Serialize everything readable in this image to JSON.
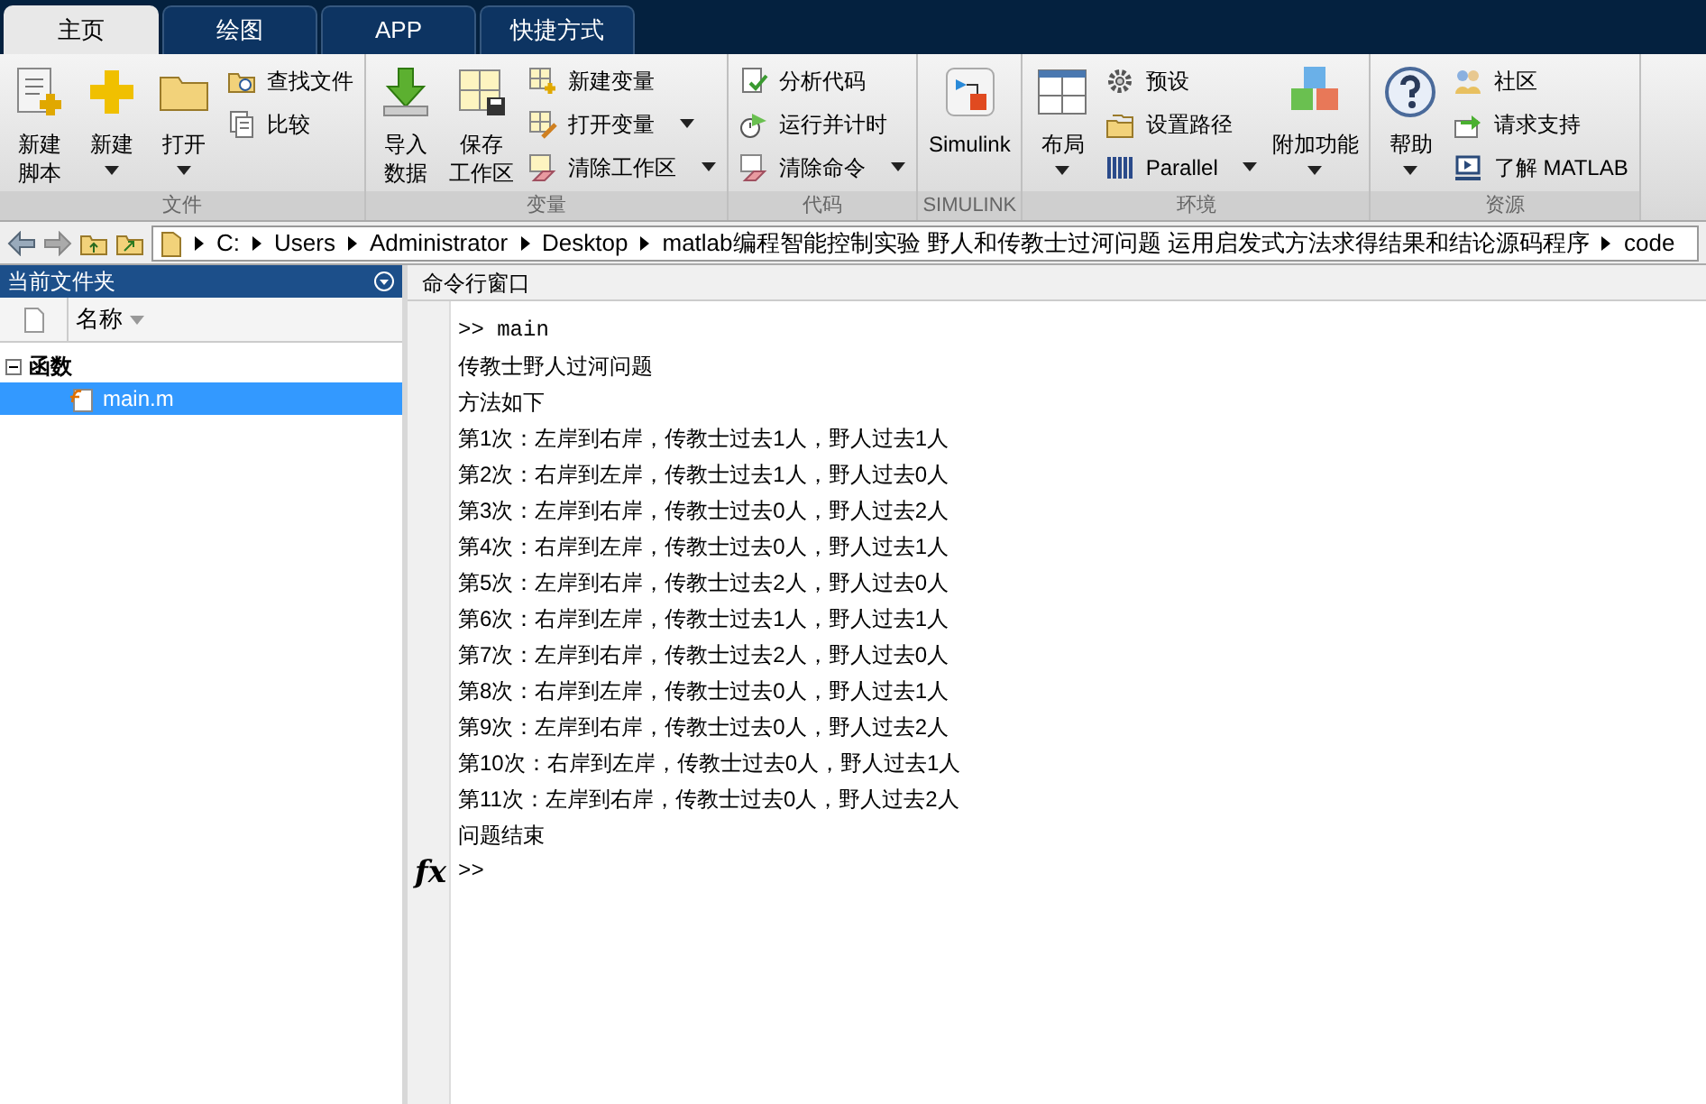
{
  "tabs": [
    {
      "label": "主页",
      "selected": true
    },
    {
      "label": "绘图",
      "selected": false
    },
    {
      "label": "APP",
      "selected": false
    },
    {
      "label": "快捷方式",
      "selected": false
    }
  ],
  "ribbon": {
    "groups": [
      {
        "label": "文件",
        "items": [
          {
            "kind": "large",
            "lines": [
              "新建",
              "脚本"
            ],
            "dropdown": false
          },
          {
            "kind": "large",
            "lines": [
              "新建"
            ],
            "dropdown": true
          },
          {
            "kind": "large",
            "lines": [
              "打开"
            ],
            "dropdown": true
          },
          {
            "kind": "stack",
            "items": [
              {
                "label": "查找文件",
                "dropdown": false
              },
              {
                "label": "比较",
                "dropdown": false
              }
            ]
          }
        ]
      },
      {
        "label": "变量",
        "items": [
          {
            "kind": "large",
            "lines": [
              "导入",
              "数据"
            ],
            "dropdown": false
          },
          {
            "kind": "large",
            "lines": [
              "保存",
              "工作区"
            ],
            "dropdown": false
          },
          {
            "kind": "stack",
            "items": [
              {
                "label": "新建变量",
                "dropdown": false
              },
              {
                "label": "打开变量",
                "dropdown": true
              },
              {
                "label": "清除工作区",
                "dropdown": true
              }
            ]
          }
        ]
      },
      {
        "label": "代码",
        "items": [
          {
            "kind": "stack",
            "items": [
              {
                "label": "分析代码",
                "dropdown": false
              },
              {
                "label": "运行并计时",
                "dropdown": false
              },
              {
                "label": "清除命令",
                "dropdown": true
              }
            ]
          }
        ]
      },
      {
        "label": "SIMULINK",
        "items": [
          {
            "kind": "large",
            "lines": [
              "Simulink"
            ],
            "dropdown": false
          }
        ]
      },
      {
        "label": "环境",
        "items": [
          {
            "kind": "large",
            "lines": [
              "布局"
            ],
            "dropdown": true
          },
          {
            "kind": "stack",
            "items": [
              {
                "label": "预设",
                "dropdown": false
              },
              {
                "label": "设置路径",
                "dropdown": false
              },
              {
                "label": "Parallel",
                "dropdown": true
              }
            ]
          },
          {
            "kind": "large",
            "lines": [
              "附加功能"
            ],
            "dropdown": true
          }
        ]
      },
      {
        "label": "资源",
        "items": [
          {
            "kind": "large",
            "lines": [
              "帮助"
            ],
            "dropdown": true
          },
          {
            "kind": "stack",
            "items": [
              {
                "label": "社区",
                "dropdown": false
              },
              {
                "label": "请求支持",
                "dropdown": false
              },
              {
                "label": "了解 MATLAB",
                "dropdown": false
              }
            ]
          }
        ]
      }
    ]
  },
  "address_bar": {
    "path": [
      "C:",
      "Users",
      "Administrator",
      "Desktop",
      "matlab编程智能控制实验 野人和传教士过河问题 运用启发式方法求得结果和结论源码程序",
      "code"
    ]
  },
  "current_folder": {
    "title": "当前文件夹",
    "column": "名称",
    "tree": [
      {
        "label": "函数",
        "expanded": true,
        "children": [
          {
            "label": "main.m",
            "selected": true
          }
        ]
      }
    ]
  },
  "command_window": {
    "title": "命令行窗口",
    "lines": [
      {
        "kind": "command",
        "text": ">> main"
      },
      {
        "kind": "output",
        "text": "传教士野人过河问题"
      },
      {
        "kind": "output",
        "text": "方法如下"
      },
      {
        "kind": "output",
        "text": "第1次：左岸到右岸，传教士过去1人，野人过去1人"
      },
      {
        "kind": "output",
        "text": "第2次：右岸到左岸，传教士过去1人，野人过去0人"
      },
      {
        "kind": "output",
        "text": "第3次：左岸到右岸，传教士过去0人，野人过去2人"
      },
      {
        "kind": "output",
        "text": "第4次：右岸到左岸，传教士过去0人，野人过去1人"
      },
      {
        "kind": "output",
        "text": "第5次：左岸到右岸，传教士过去2人，野人过去0人"
      },
      {
        "kind": "output",
        "text": "第6次：右岸到左岸，传教士过去1人，野人过去1人"
      },
      {
        "kind": "output",
        "text": "第7次：左岸到右岸，传教士过去2人，野人过去0人"
      },
      {
        "kind": "output",
        "text": "第8次：右岸到左岸，传教士过去0人，野人过去1人"
      },
      {
        "kind": "output",
        "text": "第9次：左岸到右岸，传教士过去0人，野人过去2人"
      },
      {
        "kind": "output",
        "text": "第10次：右岸到左岸，传教士过去0人，野人过去1人"
      },
      {
        "kind": "output",
        "text": "第11次：左岸到右岸，传教士过去0人，野人过去2人"
      },
      {
        "kind": "output",
        "text": "问题结束"
      }
    ],
    "prompt": ">>",
    "function_browser": "fx"
  }
}
